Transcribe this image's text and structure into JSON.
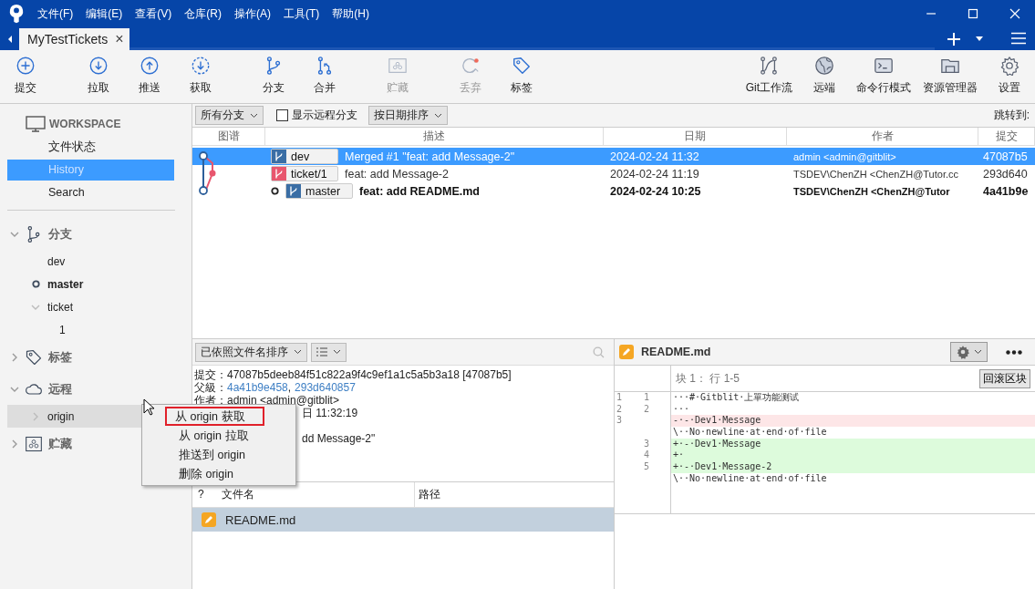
{
  "menu": [
    "文件(F)",
    "编辑(E)",
    "查看(V)",
    "仓库(R)",
    "操作(A)",
    "工具(T)",
    "帮助(H)"
  ],
  "tab": {
    "title": "MyTestTickets",
    "close": "×"
  },
  "toolbar": {
    "left": [
      {
        "label": "提交",
        "disabled": false
      },
      {
        "label": "拉取",
        "disabled": false
      },
      {
        "label": "推送",
        "disabled": false
      },
      {
        "label": "获取",
        "disabled": false
      },
      {
        "label": "分支",
        "disabled": false
      },
      {
        "label": "合并",
        "disabled": false
      },
      {
        "label": "贮藏",
        "disabled": true
      },
      {
        "label": "丢弃",
        "disabled": true
      },
      {
        "label": "标签",
        "disabled": false
      }
    ],
    "right": [
      {
        "label": "Git工作流",
        "disabled": false
      },
      {
        "label": "远端",
        "disabled": false
      },
      {
        "label": "命令行模式",
        "disabled": false
      },
      {
        "label": "资源管理器",
        "disabled": false
      },
      {
        "label": "设置",
        "disabled": false
      }
    ]
  },
  "sidebar": {
    "workspace": {
      "title": "WORKSPACE",
      "items": [
        {
          "label": "文件状态",
          "selected": false
        },
        {
          "label": "History",
          "selected": true
        },
        {
          "label": "Search",
          "selected": false
        }
      ]
    },
    "sections": [
      {
        "title": "分支",
        "expanded": true,
        "items": [
          {
            "label": "dev",
            "current": false,
            "highlighted": false
          },
          {
            "label": "master",
            "current": true,
            "highlighted": false
          },
          {
            "label": "ticket",
            "current": false,
            "highlighted": false,
            "expanded": true,
            "children": [
              {
                "label": "1",
                "current": false
              }
            ]
          }
        ]
      },
      {
        "title": "标签",
        "expanded": false
      },
      {
        "title": "远程",
        "expanded": true,
        "items": [
          {
            "label": "origin",
            "current": false,
            "highlighted": true,
            "expanded": false
          }
        ]
      },
      {
        "title": "贮藏",
        "expanded": false
      }
    ]
  },
  "history": {
    "branch_filter": "所有分支",
    "show_remote": {
      "label": "显示远程分支",
      "checked": false
    },
    "sort": "按日期排序",
    "jump_label": "跳转到:",
    "columns": [
      "图谱",
      "描述",
      "日期",
      "作者",
      "提交"
    ],
    "rows": [
      {
        "branch": "dev",
        "color": "#3a6ea5",
        "description": "Merged #1 \"feat: add Message-2\"",
        "date": "2024-02-24 11:32",
        "author": "admin <admin@gitblit>",
        "commit": "47087b5",
        "selected": true,
        "current": false
      },
      {
        "branch": "ticket/1",
        "color": "#e8566e",
        "description": "feat: add Message-2",
        "date": "2024-02-24 11:19",
        "author": "TSDEV\\ChenZH <ChenZH@Tutor.cc",
        "commit": "293d640",
        "selected": false,
        "current": false
      },
      {
        "branch": "master",
        "color": "#3a6ea5",
        "description": "feat: add README.md",
        "date": "2024-02-24 10:25",
        "author": "TSDEV\\ChenZH <ChenZH@Tutor",
        "commit": "4a41b9e",
        "selected": false,
        "current": true
      }
    ]
  },
  "details": {
    "sort": "已依照文件名排序",
    "commit_label": "提交：",
    "commit_value": "47087b5deeb84f51c822a9f4c9ef1a1c5a5b3a18 [47087b5]",
    "parents_label": "父級：",
    "parents": [
      "4a41b9e458",
      "293d640857"
    ],
    "parents_separator": ",",
    "author_label": "作者：",
    "author_value": "admin <admin@gitblit>",
    "date_fragment": "日 11:32:19",
    "message_fragment": "dd Message-2\"",
    "file_columns": [
      "?",
      "文件名",
      "路径"
    ],
    "files": [
      {
        "name": "README.md",
        "selected": true
      }
    ]
  },
  "diff": {
    "file": "README.md",
    "hunk": "块 1： 行 1-5",
    "revert": "回滚区块",
    "lines": [
      {
        "old": "1",
        "new": "1",
        "text": "···#·Gitblit·上單功能测试",
        "kind": "context"
      },
      {
        "old": "2",
        "new": "2",
        "text": "···",
        "kind": "context"
      },
      {
        "old": "3",
        "text": "-·-·Dev1·Message",
        "kind": "removed"
      },
      {
        "text": "\\··No·newline·at·end·of·file",
        "kind": "context"
      },
      {
        "new": "3",
        "text": "+·-·Dev1·Message",
        "kind": "added"
      },
      {
        "new": "4",
        "text": "+·",
        "kind": "added"
      },
      {
        "new": "5",
        "text": "+·-·Dev1·Message-2",
        "kind": "added"
      },
      {
        "text": "\\··No·newline·at·end·of·file",
        "kind": "context"
      }
    ]
  },
  "context_menu": [
    {
      "label": "从 origin 获取",
      "selected": true
    },
    {
      "label": "从 origin 拉取",
      "selected": false
    },
    {
      "label": "推送到 origin",
      "selected": false
    },
    {
      "label": "删除 origin",
      "selected": false
    }
  ]
}
